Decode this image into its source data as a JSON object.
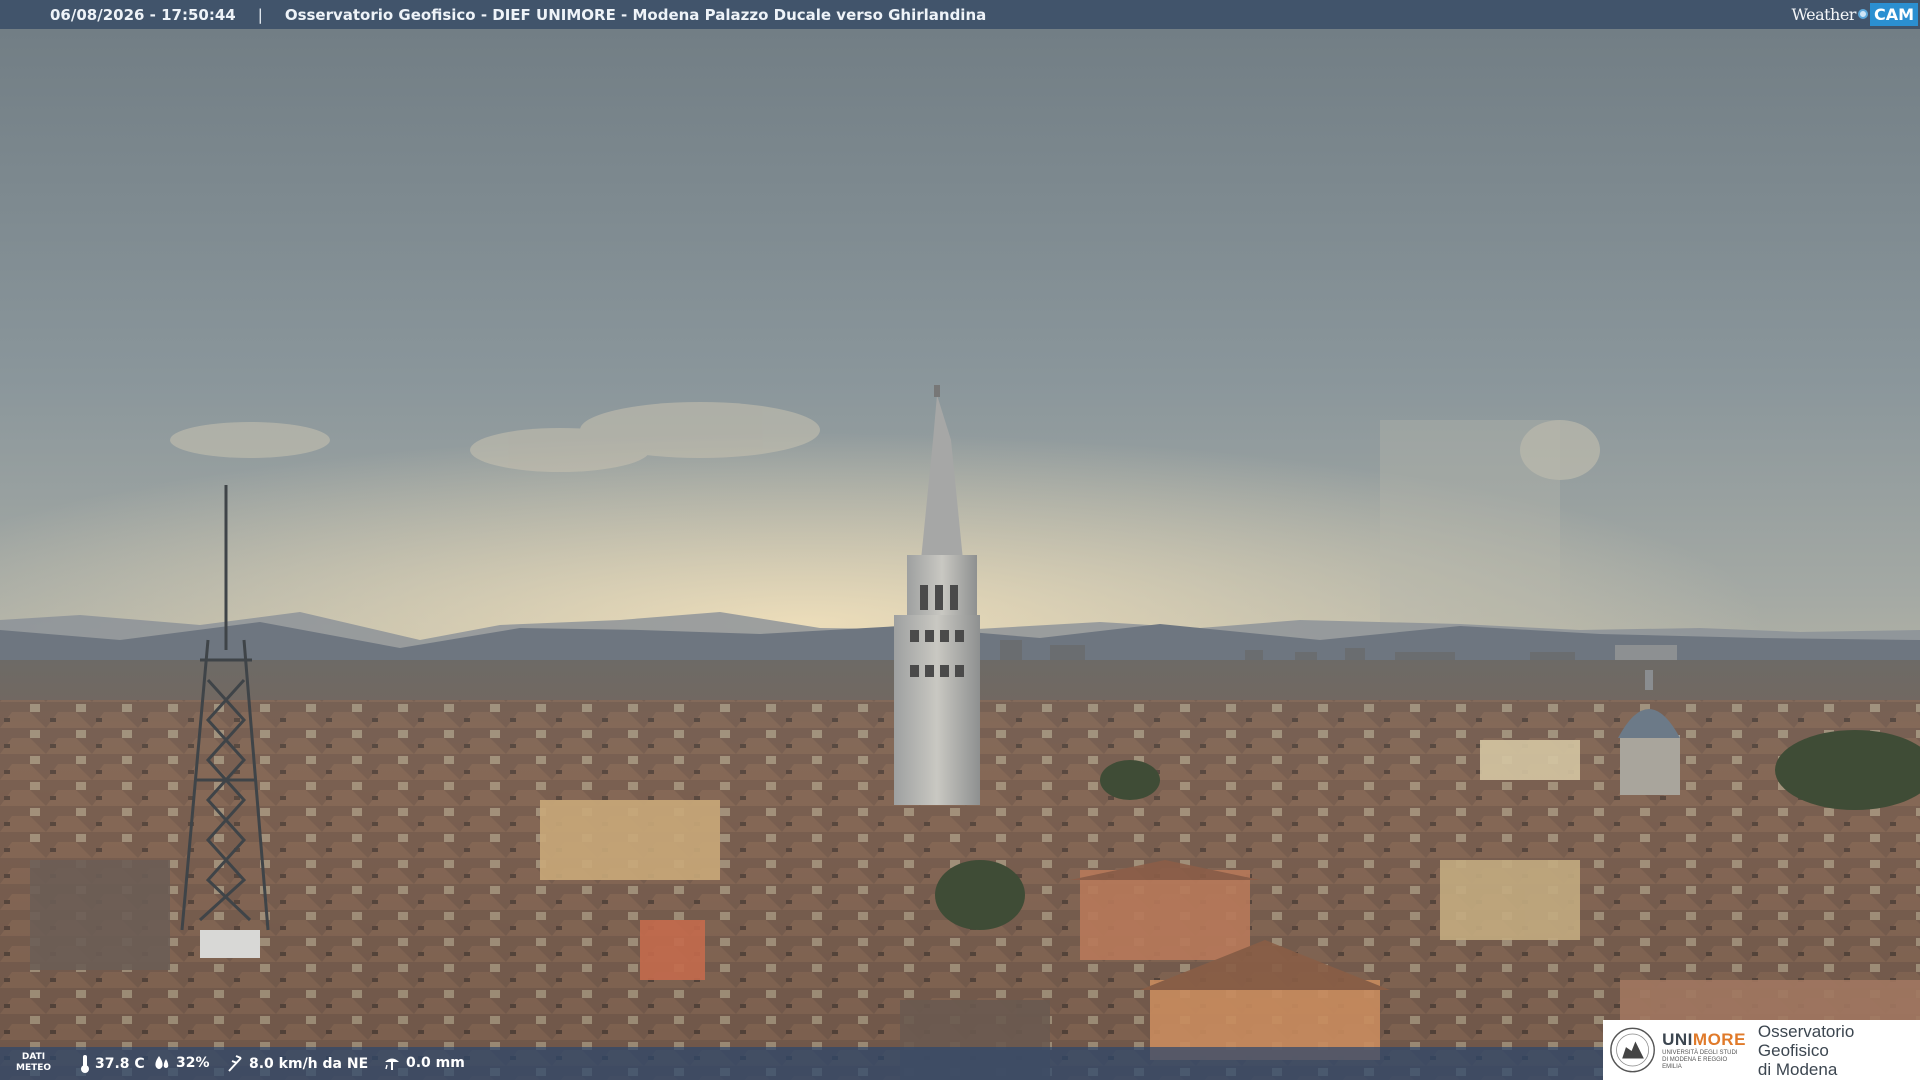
{
  "header": {
    "timestamp": "06/08/2026 - 17:50:44",
    "separator": "|",
    "title": "Osservatorio Geofisico - DIEF UNIMORE - Modena Palazzo Ducale verso Ghirlandina",
    "brand_word": "Weather",
    "brand_cam": "CAM"
  },
  "meteo": {
    "label_line1": "DATI",
    "label_line2": "METEO",
    "temperature": "37.8 C",
    "humidity": "32%",
    "wind": "8.0 km/h da NE",
    "rain": "0.0 mm"
  },
  "logo": {
    "university": "UNI",
    "university_accent": "MORE",
    "university_sub": "UNIVERSITÀ DEGLI STUDI DI MODENA E REGGIO EMILIA",
    "observatory_line1": "Osservatorio Geofisico",
    "observatory_line2": "di Modena"
  },
  "colors": {
    "bar": "#3a4e68",
    "brand_accent": "#2b8fd1",
    "unimore_orange": "#e07a2a"
  }
}
